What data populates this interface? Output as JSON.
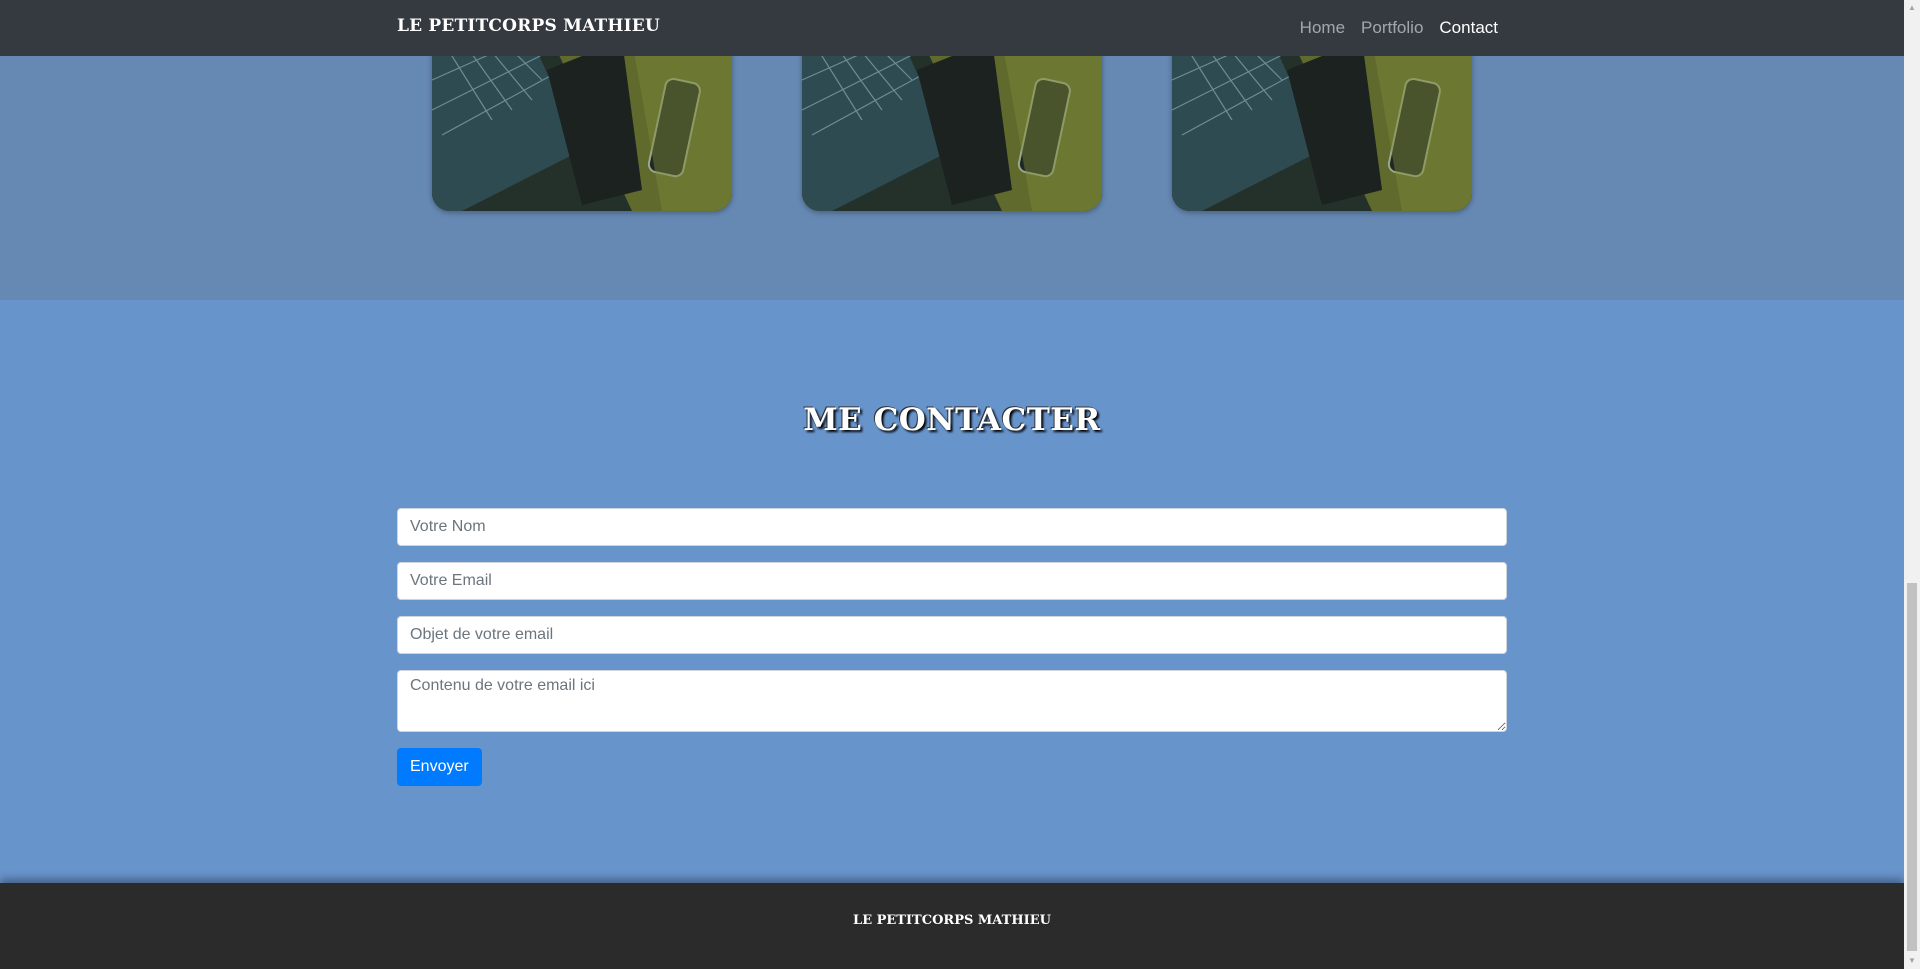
{
  "navbar": {
    "brand": "LE PETITCORPS MATHIEU",
    "links": [
      {
        "label": "Home",
        "active": false
      },
      {
        "label": "Portfolio",
        "active": false
      },
      {
        "label": "Contact",
        "active": true
      }
    ]
  },
  "portfolio": {
    "images": [
      "laptop-phone-photo",
      "laptop-phone-photo",
      "laptop-phone-photo"
    ]
  },
  "contact": {
    "title": "ME CONTACTER",
    "fields": {
      "name_placeholder": "Votre Nom",
      "email_placeholder": "Votre Email",
      "subject_placeholder": "Objet de votre email",
      "message_placeholder": "Contenu de votre email ici"
    },
    "submit_label": "Envoyer"
  },
  "footer": {
    "brand": "LE PETITCORPS MATHIEU"
  },
  "colors": {
    "navbar_bg": "#343a40",
    "portfolio_bg": "#6689b4",
    "contact_bg": "#6894cc",
    "footer_bg": "#2b2b2b",
    "button": "#007bff"
  }
}
